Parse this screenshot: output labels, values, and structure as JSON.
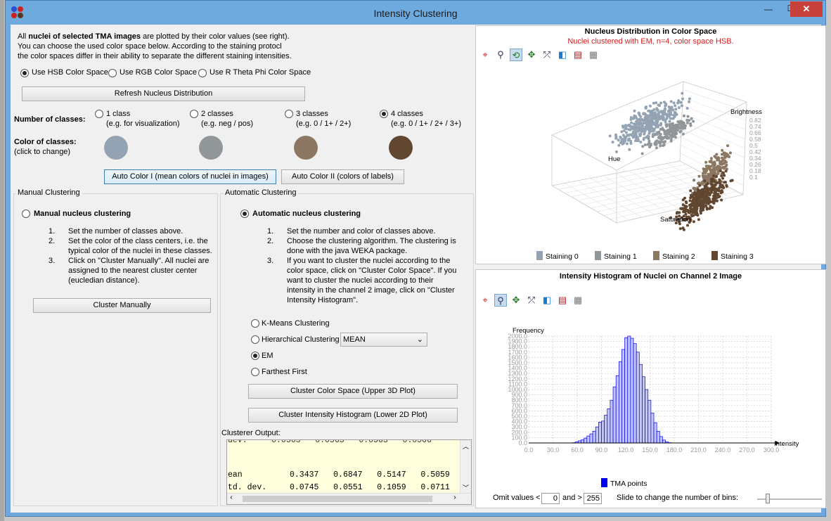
{
  "window": {
    "title": "Intensity Clustering",
    "minimize": "—",
    "maximize": "☐",
    "close": "✕"
  },
  "intro": {
    "line1_pre": "All ",
    "line1_bold": "nuclei of selected TMA images",
    "line1_post": " are plotted by their color values (see right).",
    "line2": "You can choose the used color space below. According to the staining protocl",
    "line3": "the color spaces differ in their ability to separate the different staining intensities."
  },
  "color_space": {
    "options": [
      "Use HSB Color Space",
      "Use RGB Color Space",
      "Use R Theta Phi Color Space"
    ],
    "selected": 0
  },
  "refresh_button": "Refresh Nucleus Distribution",
  "classes": {
    "label": "Number of classes:",
    "options": [
      {
        "label": "1 class",
        "example": "(e.g. for visualization)"
      },
      {
        "label": "2 classes",
        "example": "(e.g. neg / pos)"
      },
      {
        "label": "3 classes",
        "example": "(e.g. 0 / 1+ / 2+)"
      },
      {
        "label": "4 classes",
        "example": "(e.g. 0 / 1+ / 2+ / 3+)"
      }
    ],
    "selected": 3,
    "color_label": "Color of classes:",
    "color_hint": "(click to change)",
    "colors": [
      "#94a3b3",
      "#919699",
      "#8c7762",
      "#614630"
    ]
  },
  "auto_color": {
    "button1": "Auto Color I (mean colors of nuclei in images)",
    "button2": "Auto Color II (colors of labels)"
  },
  "manual": {
    "group_title": "Manual Clustering",
    "radio_label": "Manual nucleus clustering",
    "steps": [
      "Set the number of classes above.",
      "Set the color of the class centers, i.e. the typical color of the nuclei in these classes.",
      "Click on \"Cluster Manually\". All nuclei are assigned to the nearest cluster center (eucledian distance)."
    ],
    "button": "Cluster Manually"
  },
  "automatic": {
    "group_title": "Automatic Clustering",
    "radio_label": "Automatic nucleus clustering",
    "steps": [
      "Set the number and color of classes above.",
      "Choose the clustering algorithm. The clustering is done with the java WEKA package.",
      "If you want to cluster the nuclei according to the color space, click on \"Cluster Color Space\". If you want to cluster the nuclei according to their intensity in the channel 2 image, click on \"Cluster Intensity Histogram\"."
    ],
    "algorithms": [
      "K-Means Clustering",
      "Hierarchical Clustering",
      "EM",
      "Farthest First"
    ],
    "selected_algorithm": 2,
    "linkage_value": "MEAN",
    "button_color_space": "Cluster Color Space (Upper 3D Plot)",
    "button_histogram": "Cluster Intensity Histogram (Lower 2D Plot)"
  },
  "clusterer_output": {
    "label": "Clusterer Output:",
    "rows": [
      {
        "name": "ean",
        "values": [
          "0.3437",
          "0.6847",
          "0.5147",
          "0.5059"
        ]
      },
      {
        "name": "td. dev.",
        "values": [
          "0.0745",
          "0.0551",
          "0.1059",
          "0.0711"
        ]
      }
    ]
  },
  "plot3d": {
    "title": "Nucleus Distribution in Color Space",
    "subtitle": "Nuclei clustered with EM, n=4, color space HSB.",
    "axis_brightness": "Brightness",
    "axis_hue": "Hue",
    "axis_saturation": "Saturation",
    "brightness_ticks": [
      "0.82",
      "0.74",
      "0.66",
      "0.58",
      "0.5",
      "0.42",
      "0.34",
      "0.26",
      "0.18",
      "0.1"
    ],
    "legend": [
      {
        "label": "Staining 0",
        "color": "#94a3b3"
      },
      {
        "label": "Staining 1",
        "color": "#919699"
      },
      {
        "label": "Staining 2",
        "color": "#8c7762"
      },
      {
        "label": "Staining 3",
        "color": "#614630"
      }
    ]
  },
  "histogram": {
    "title": "Intensity Histogram of Nuclei on Channel 2 Image",
    "legend": "TMA points",
    "omit_label": "Omit values <",
    "omit_min": "0",
    "and_label": "and >",
    "omit_max": "255",
    "bins_label": "Slide to change the number of bins:"
  },
  "chart_data": {
    "type": "bar",
    "xlabel": "Intensity",
    "ylabel": "Frequency",
    "x_ticks": [
      "0.0",
      "30.0",
      "60.0",
      "90.0",
      "120.0",
      "150.0",
      "180.0",
      "210.0",
      "240.0",
      "270.0",
      "300.0"
    ],
    "y_ticks": [
      "0.0",
      "100.0",
      "200.0",
      "300.0",
      "400.0",
      "500.0",
      "600.0",
      "700.0",
      "800.0",
      "900.0",
      "1000.0",
      "1100.0",
      "1200.0",
      "1300.0",
      "1400.0",
      "1500.0",
      "1600.0",
      "1700.0",
      "1800.0",
      "1900.0",
      "2000.0"
    ],
    "xlim": [
      0,
      300
    ],
    "ylim": [
      0,
      2000
    ],
    "bin_width": 3.6,
    "x": [
      54,
      57.6,
      61.2,
      64.8,
      68.4,
      72,
      75.6,
      79.2,
      82.8,
      86.4,
      90,
      93.6,
      97.2,
      100.8,
      104.4,
      108,
      111.6,
      115.2,
      118.8,
      122.4,
      126,
      129.6,
      133.2,
      136.8,
      140.4,
      144,
      147.6,
      151.2,
      154.8,
      158.4,
      162,
      165.6,
      169.2,
      172.8,
      176.4,
      180
    ],
    "values": [
      5,
      20,
      40,
      60,
      90,
      130,
      170,
      220,
      300,
      390,
      410,
      520,
      640,
      800,
      1050,
      1260,
      1520,
      1750,
      1970,
      2000,
      1960,
      1860,
      1700,
      1470,
      1240,
      1000,
      800,
      560,
      380,
      220,
      120,
      55,
      20,
      5,
      2,
      1
    ],
    "series": [
      {
        "name": "TMA points",
        "color": "#0000ee"
      }
    ],
    "grid": true,
    "legend_position": "bottom"
  }
}
